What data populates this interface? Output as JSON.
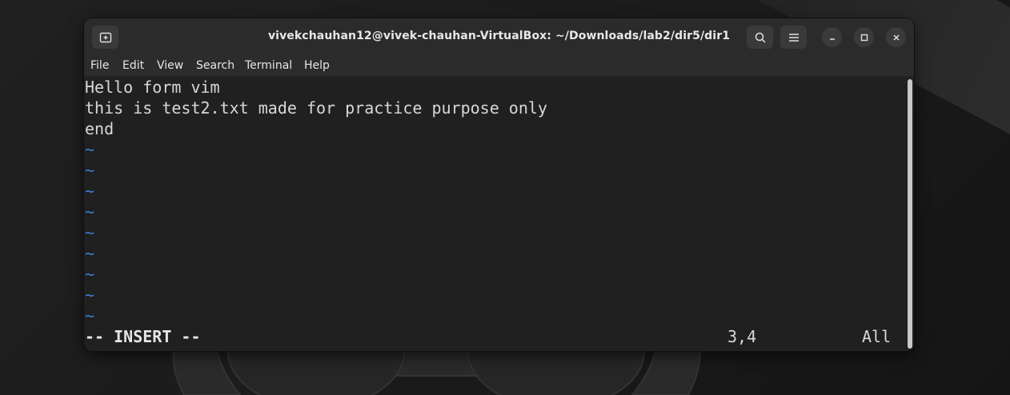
{
  "window": {
    "title": "vivekchauhan12@vivek-chauhan-VirtualBox: ~/Downloads/lab2/dir5/dir1"
  },
  "menu": {
    "items": [
      "File",
      "Edit",
      "View",
      "Search",
      "Terminal",
      "Help"
    ]
  },
  "editor": {
    "lines": [
      "Hello form vim",
      "this is test2.txt made for practice purpose only",
      "end"
    ],
    "tilde": "~",
    "status": {
      "mode": "-- INSERT --",
      "position": "3,4",
      "scroll": "All"
    }
  },
  "colors": {
    "tilde": "#3f7fd6",
    "terminal_text": "#d8d8d8",
    "titlebar": "#2b2b2b"
  },
  "icons": {
    "new_tab": "new-tab-icon",
    "search": "search-icon",
    "menu": "hamburger-menu-icon",
    "minimize": "minimize-icon",
    "maximize": "maximize-icon",
    "close": "close-icon"
  }
}
